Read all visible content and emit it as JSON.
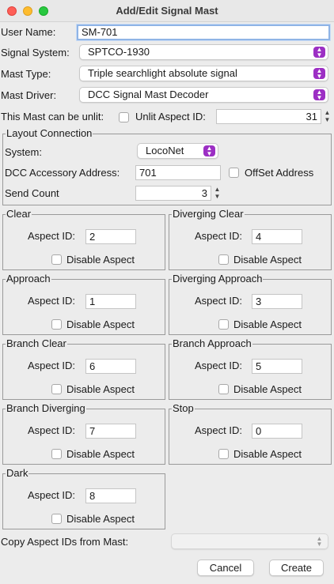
{
  "window": {
    "title": "Add/Edit Signal Mast"
  },
  "form": {
    "user_name_label": "User Name:",
    "user_name_value": "SM-701",
    "signal_system_label": "Signal System:",
    "signal_system_value": "SPTCO-1930",
    "mast_type_label": "Mast Type:",
    "mast_type_value": "Triple searchlight absolute signal",
    "mast_driver_label": "Mast Driver:",
    "mast_driver_value": "DCC Signal Mast Decoder",
    "unlit_label": "This Mast can be unlit:",
    "unlit_checked": false,
    "unlit_aspect_label": "Unlit Aspect ID:",
    "unlit_aspect_value": "31"
  },
  "layout": {
    "title": "Layout Connection",
    "system_label": "System:",
    "system_value": "LocoNet",
    "dcc_address_label": "DCC Accessory Address:",
    "dcc_address_value": "701",
    "offset_label": "OffSet Address",
    "offset_checked": false,
    "send_count_label": "Send Count",
    "send_count_value": "3"
  },
  "aspects": [
    {
      "name": "Clear",
      "id_label": "Aspect ID:",
      "id_value": "2",
      "disable_label": "Disable Aspect"
    },
    {
      "name": "Diverging Clear",
      "id_label": "Aspect ID:",
      "id_value": "4",
      "disable_label": "Disable Aspect"
    },
    {
      "name": "Approach",
      "id_label": "Aspect ID:",
      "id_value": "1",
      "disable_label": "Disable Aspect"
    },
    {
      "name": "Diverging Approach",
      "id_label": "Aspect ID:",
      "id_value": "3",
      "disable_label": "Disable Aspect"
    },
    {
      "name": "Branch Clear",
      "id_label": "Aspect ID:",
      "id_value": "6",
      "disable_label": "Disable Aspect"
    },
    {
      "name": "Branch Approach",
      "id_label": "Aspect ID:",
      "id_value": "5",
      "disable_label": "Disable Aspect"
    },
    {
      "name": "Branch Diverging",
      "id_label": "Aspect ID:",
      "id_value": "7",
      "disable_label": "Disable Aspect"
    },
    {
      "name": "Stop",
      "id_label": "Aspect ID:",
      "id_value": "0",
      "disable_label": "Disable Aspect"
    },
    {
      "name": "Dark",
      "id_label": "Aspect ID:",
      "id_value": "8",
      "disable_label": "Disable Aspect"
    }
  ],
  "copy": {
    "label": "Copy Aspect IDs from Mast:",
    "value": ""
  },
  "buttons": {
    "cancel": "Cancel",
    "create": "Create"
  },
  "colors": {
    "accent": "#9c2fc4",
    "focus": "#8fb4e6",
    "window_bg": "#ececec"
  },
  "icons": {
    "combo_arrow": "updown-chevron-icon",
    "stepper": "stepper-icon"
  }
}
